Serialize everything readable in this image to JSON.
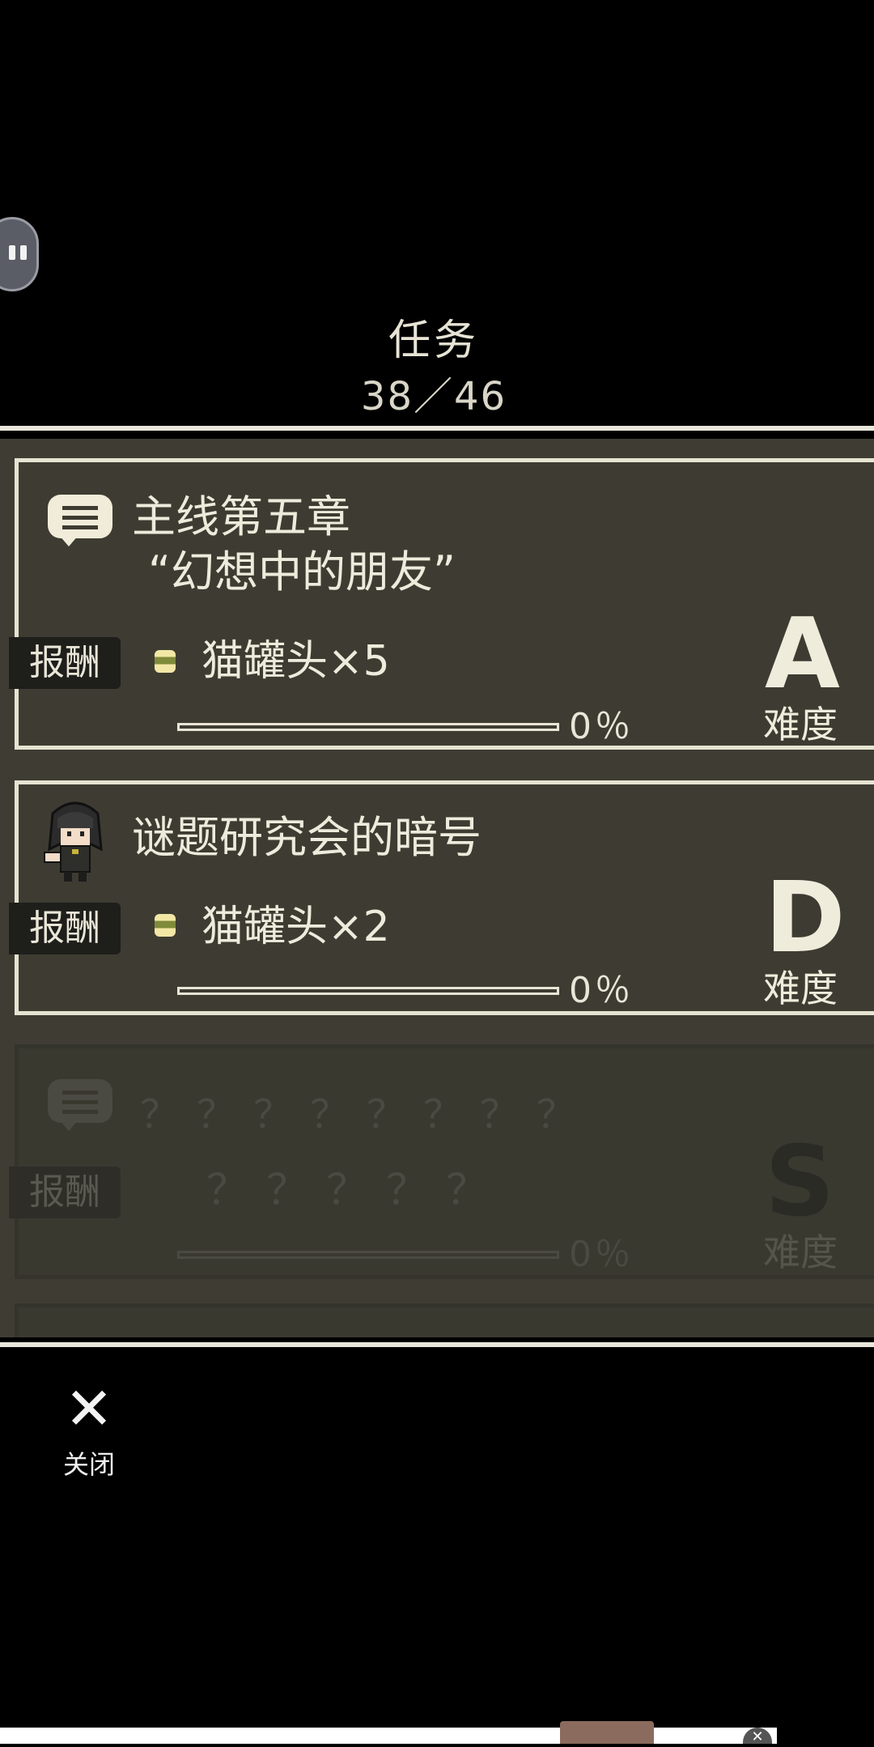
{
  "header": {
    "title": "任务",
    "count": "38／46"
  },
  "quests": [
    {
      "icon": "speech-bubble-icon",
      "name": "主线第五章",
      "subtitle": "“幻想中的朋友”",
      "reward_label": "报酬",
      "reward": "猫罐头×5",
      "progress": 0,
      "progress_text": "0％",
      "grade": "A",
      "difficulty_label": "难度"
    },
    {
      "icon": "character-avatar-icon",
      "name": "谜题研究会的暗号",
      "reward_label": "报酬",
      "reward": "猫罐头×2",
      "progress": 0,
      "progress_text": "0％",
      "grade": "D",
      "difficulty_label": "难度"
    },
    {
      "icon": "speech-bubble-icon",
      "name": "？？？？？？？？",
      "reward_label": "报酬",
      "reward": "？？？？？",
      "progress": 0,
      "progress_text": "0％",
      "grade": "S",
      "difficulty_label": "难度",
      "locked": true
    }
  ],
  "footer": {
    "close_icon": "close-icon",
    "close_label": "关闭"
  },
  "colors": {
    "background": "#000000",
    "card": "#3e3c32",
    "border": "#e7e3d2",
    "text": "#eeebdc"
  }
}
